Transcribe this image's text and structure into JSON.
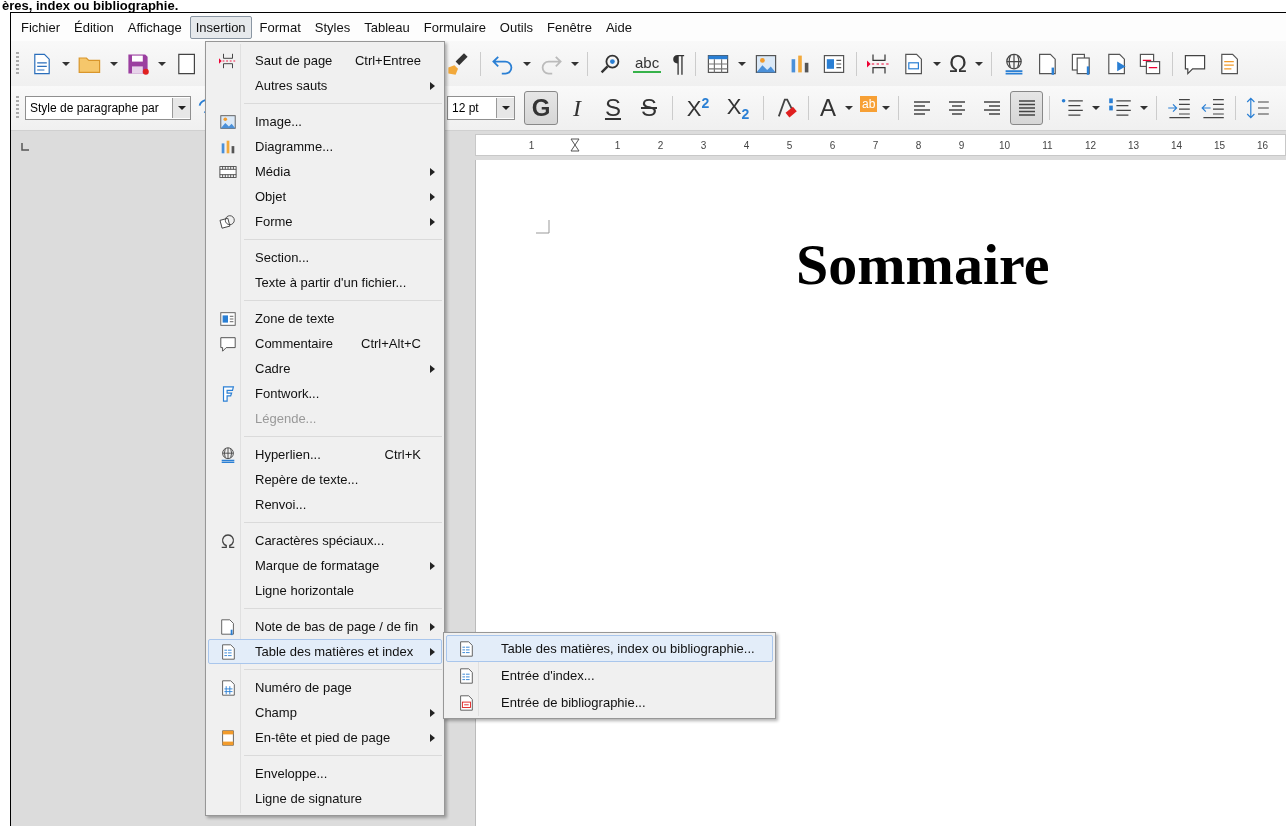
{
  "heading_fragment": "ères, index ou bibliographie.",
  "menubar": [
    {
      "label": "Fichier",
      "selected": false
    },
    {
      "label": "Édition",
      "selected": false
    },
    {
      "label": "Affichage",
      "selected": false
    },
    {
      "label": "Insertion",
      "selected": true
    },
    {
      "label": "Format",
      "selected": false
    },
    {
      "label": "Styles",
      "selected": false
    },
    {
      "label": "Tableau",
      "selected": false
    },
    {
      "label": "Formulaire",
      "selected": false
    },
    {
      "label": "Outils",
      "selected": false
    },
    {
      "label": "Fenêtre",
      "selected": false
    },
    {
      "label": "Aide",
      "selected": false
    }
  ],
  "toolbar_standard": {
    "spelling_glyph": "abc",
    "formatting_marks_glyph": "¶",
    "special_character_glyph": "Ω"
  },
  "toolbar_formatting": {
    "paragraph_style": "Style de paragraphe par",
    "font_size": "12 pt",
    "style_buttons": [
      {
        "kind": "bold",
        "glyph": "G",
        "pressed": true
      },
      {
        "kind": "italic",
        "glyph": "I",
        "pressed": false
      },
      {
        "kind": "underline",
        "glyph": "S",
        "pressed": false
      },
      {
        "kind": "strike",
        "glyph": "S",
        "pressed": false
      }
    ],
    "script_buttons": [
      {
        "glyph": "X$^{2}$",
        "pressed": false
      },
      {
        "glyph": "X$_{2}$",
        "pressed": false
      }
    ],
    "font_color_glyph": "A",
    "highlight_glyph": "ab",
    "alignment": [
      {
        "kind": "left",
        "selected": false
      },
      {
        "kind": "center",
        "selected": false
      },
      {
        "kind": "right",
        "selected": false
      },
      {
        "kind": "justify",
        "selected": true
      }
    ]
  },
  "ruler": {
    "labels": [
      "1",
      "1",
      "2",
      "3",
      "4",
      "5",
      "6",
      "7",
      "8",
      "9",
      "10",
      "11",
      "12",
      "13",
      "14",
      "15",
      "16"
    ]
  },
  "document": {
    "title": "Sommaire"
  },
  "menu": {
    "groups": [
      [
        {
          "label": "Saut de page",
          "shortcut": "Ctrl+Entree",
          "has_submenu": false,
          "disabled": false,
          "selected": false
        },
        {
          "label": "Autres sauts",
          "has_submenu": true,
          "disabled": false,
          "selected": false
        }
      ],
      [
        {
          "label": "Image...",
          "has_submenu": false,
          "disabled": false,
          "selected": false
        },
        {
          "label": "Diagramme...",
          "has_submenu": false,
          "disabled": false,
          "selected": false
        },
        {
          "label": "Média",
          "has_submenu": true,
          "disabled": false,
          "selected": false
        },
        {
          "label": "Objet",
          "has_submenu": true,
          "disabled": false,
          "selected": false
        },
        {
          "label": "Forme",
          "has_submenu": true,
          "disabled": false,
          "selected": false
        }
      ],
      [
        {
          "label": "Section...",
          "has_submenu": false,
          "disabled": false,
          "selected": false
        },
        {
          "label": "Texte à partir d'un fichier...",
          "has_submenu": false,
          "disabled": false,
          "selected": false
        }
      ],
      [
        {
          "label": "Zone de texte",
          "has_submenu": false,
          "disabled": false,
          "selected": false
        },
        {
          "label": "Commentaire",
          "shortcut": "Ctrl+Alt+C",
          "has_submenu": false,
          "disabled": false,
          "selected": false
        },
        {
          "label": "Cadre",
          "has_submenu": true,
          "disabled": false,
          "selected": false
        },
        {
          "label": "Fontwork...",
          "has_submenu": false,
          "disabled": false,
          "selected": false
        },
        {
          "label": "Légende...",
          "has_submenu": false,
          "disabled": true,
          "selected": false
        }
      ],
      [
        {
          "label": "Hyperlien...",
          "shortcut": "Ctrl+K",
          "has_submenu": false,
          "disabled": false,
          "selected": false
        },
        {
          "label": "Repère de texte...",
          "has_submenu": false,
          "disabled": false,
          "selected": false
        },
        {
          "label": "Renvoi...",
          "has_submenu": false,
          "disabled": false,
          "selected": false
        }
      ],
      [
        {
          "label": "Caractères spéciaux...",
          "has_submenu": false,
          "disabled": false,
          "selected": false
        },
        {
          "label": "Marque de formatage",
          "has_submenu": true,
          "disabled": false,
          "selected": false
        },
        {
          "label": "Ligne horizontale",
          "has_submenu": false,
          "disabled": false,
          "selected": false
        }
      ],
      [
        {
          "label": "Note de bas de page / de fin",
          "has_submenu": true,
          "disabled": false,
          "selected": false
        },
        {
          "label": "Table des matières et index",
          "has_submenu": true,
          "disabled": false,
          "selected": true,
          "submenu": [
            {
              "label": "Table des matières, index ou bibliographie...",
              "selected": true
            },
            {
              "label": "Entrée d'index...",
              "selected": false
            },
            {
              "label": "Entrée de bibliographie...",
              "selected": false
            }
          ]
        }
      ],
      [
        {
          "label": "Numéro de page",
          "has_submenu": false,
          "disabled": false,
          "selected": false
        },
        {
          "label": "Champ",
          "has_submenu": true,
          "disabled": false,
          "selected": false
        },
        {
          "label": "En-tête et pied de page",
          "has_submenu": true,
          "disabled": false,
          "selected": false
        }
      ],
      [
        {
          "label": "Enveloppe...",
          "has_submenu": false,
          "disabled": false,
          "selected": false
        },
        {
          "label": "Ligne de signature",
          "has_submenu": false,
          "disabled": false,
          "selected": false
        }
      ]
    ]
  }
}
